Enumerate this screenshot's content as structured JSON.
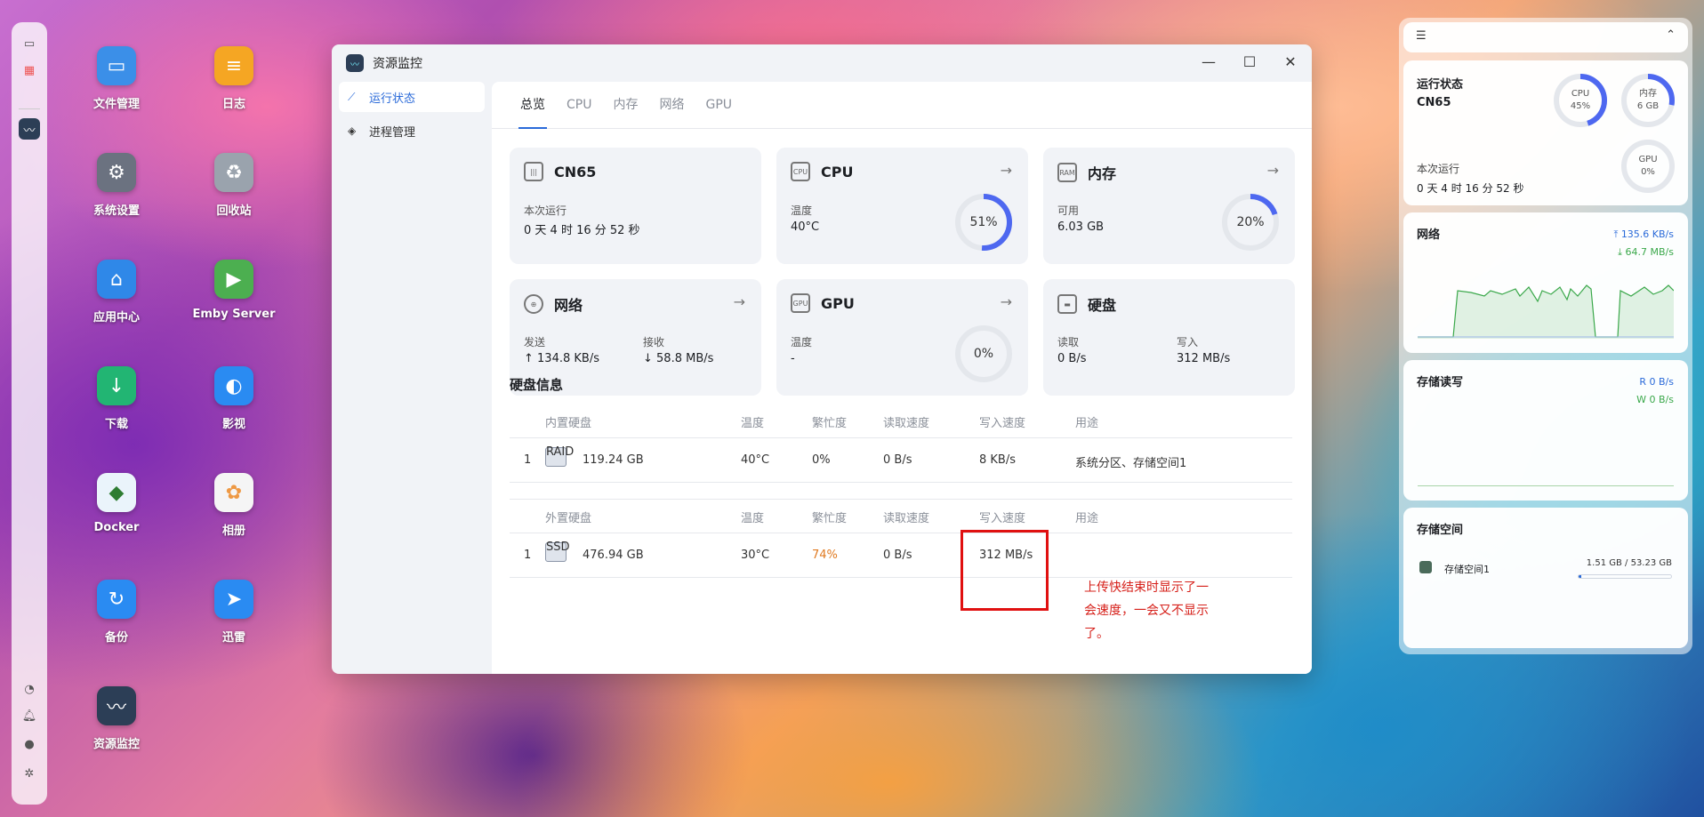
{
  "desktop": {
    "apps": [
      {
        "label": "文件管理",
        "icon": "folder-icon",
        "color": "#3b8fe8"
      },
      {
        "label": "日志",
        "icon": "log-icon",
        "color": "#f5a623"
      },
      {
        "label": "系统设置",
        "icon": "gear-icon",
        "color": "#6b7280"
      },
      {
        "label": "回收站",
        "icon": "recycle-bin-icon",
        "color": "#9aa3ad"
      },
      {
        "label": "应用中心",
        "icon": "store-icon",
        "color": "#2f88e8"
      },
      {
        "label": "Emby Server",
        "icon": "emby-icon",
        "color": "#4caf50"
      },
      {
        "label": "下载",
        "icon": "download-icon",
        "color": "#22b573"
      },
      {
        "label": "影视",
        "icon": "video-icon",
        "color": "#2a8bf2"
      },
      {
        "label": "Docker",
        "icon": "docker-icon",
        "color": "#eaf4fb"
      },
      {
        "label": "相册",
        "icon": "photos-icon",
        "color": "#f5f5f5"
      },
      {
        "label": "备份",
        "icon": "backup-icon",
        "color": "#2a8bf2"
      },
      {
        "label": "迅雷",
        "icon": "thunder-icon",
        "color": "#2a8bf2"
      },
      {
        "label": "资源监控",
        "icon": "monitor-icon",
        "color": "#2c3e56"
      }
    ]
  },
  "window": {
    "title": "资源监控",
    "sidebar": [
      {
        "label": "运行状态",
        "icon": "chart-line-icon",
        "active": true
      },
      {
        "label": "进程管理",
        "icon": "layers-icon",
        "active": false
      }
    ],
    "tabs": [
      "总览",
      "CPU",
      "内存",
      "网络",
      "GPU"
    ],
    "cards": {
      "device": {
        "title": "CN65",
        "k1": "本次运行",
        "v1": "0 天 4 时 16 分 52 秒"
      },
      "cpu": {
        "title": "CPU",
        "k1": "温度",
        "v1": "40°C",
        "ring": "51%",
        "pct": 51
      },
      "mem": {
        "title": "内存",
        "k1": "可用",
        "v1": "6.03 GB",
        "ring": "20%",
        "pct": 20
      },
      "net": {
        "title": "网络",
        "k1": "发送",
        "v1": "↑ 134.8 KB/s",
        "k2": "接收",
        "v2": "↓ 58.8 MB/s"
      },
      "gpu": {
        "title": "GPU",
        "k1": "温度",
        "v1": "-",
        "ring": "0%",
        "pct": 0
      },
      "disk": {
        "title": "硬盘",
        "k1": "读取",
        "v1": "0 B/s",
        "k2": "写入",
        "v2": "312 MB/s"
      }
    },
    "disk_section_title": "硬盘信息",
    "internal": {
      "headers": [
        "内置硬盘",
        "温度",
        "繁忙度",
        "读取速度",
        "写入速度",
        "用途"
      ],
      "rows": [
        {
          "idx": "1",
          "badge": "RAID",
          "size": "119.24 GB",
          "temp": "40°C",
          "busy": "0%",
          "read": "0 B/s",
          "write": "8 KB/s",
          "use": "系统分区、存储空间1"
        }
      ]
    },
    "external": {
      "headers": [
        "外置硬盘",
        "温度",
        "繁忙度",
        "读取速度",
        "写入速度",
        "用途"
      ],
      "rows": [
        {
          "idx": "1",
          "badge": "SSD",
          "size": "476.94 GB",
          "temp": "30°C",
          "busy": "74%",
          "read": "0 B/s",
          "write": "312 MB/s",
          "use": ""
        }
      ]
    },
    "annotation": "上传快结束时显示了一会速度，一会又不显示了。"
  },
  "widgets": {
    "status": {
      "title": "运行状态",
      "device": "CN65",
      "runtime_label": "本次运行",
      "runtime": "0 天 4 时 16 分 52 秒",
      "cpu": {
        "label": "CPU",
        "value": "45%",
        "pct": 45
      },
      "mem": {
        "label": "内存",
        "value": "6 GB",
        "pct": 28
      },
      "gpu": {
        "label": "GPU",
        "value": "0%",
        "pct": 0
      }
    },
    "network": {
      "title": "网络",
      "up": "135.6 KB/s",
      "down": "64.7 MB/s"
    },
    "storage_io": {
      "title": "存储读写",
      "read": "R  0 B/s",
      "write": "W  0 B/s"
    },
    "storage": {
      "title": "存储空间",
      "name": "存储空间1",
      "usage": "1.51 GB / 53.23 GB",
      "pct": 3
    }
  },
  "colors": {
    "accent": "#2a6ad9",
    "ring": "#4e68f0",
    "busy_warn": "#e07a20",
    "annotation": "#d6201a",
    "net_up": "#2a6ad9",
    "net_down": "#3aa84a"
  }
}
